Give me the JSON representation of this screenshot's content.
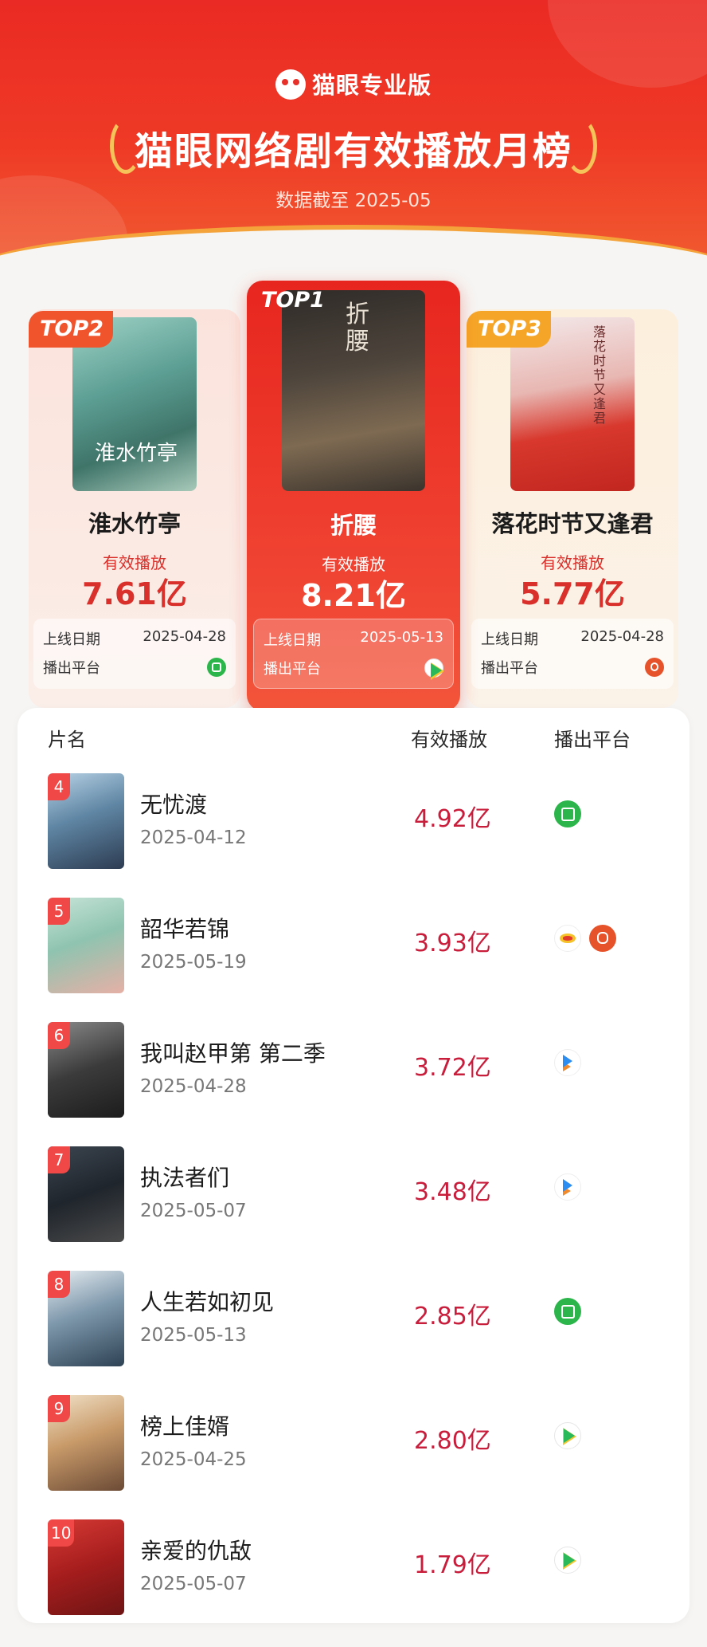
{
  "header": {
    "brand": "猫眼专业版",
    "title": "猫眼网络剧有效播放月榜",
    "subtitle": "数据截至 2025-05"
  },
  "top_cards": [
    {
      "tag": "TOP2",
      "name": "淮水竹亭",
      "label": "有效播放",
      "value": "7.61亿",
      "date_label": "上线日期",
      "date": "2025-04-28",
      "platform_label": "播出平台",
      "platform": "iqiyi-icon",
      "poster_text": "淮水竹亭"
    },
    {
      "tag": "TOP1",
      "name": "折腰",
      "label": "有效播放",
      "value": "8.21亿",
      "date_label": "上线日期",
      "date": "2025-05-13",
      "platform_label": "播出平台",
      "platform": "tencent-video-icon",
      "poster_text": "折腰"
    },
    {
      "tag": "TOP3",
      "name": "落花时节又逢君",
      "label": "有效播放",
      "value": "5.77亿",
      "date_label": "上线日期",
      "date": "2025-04-28",
      "platform_label": "播出平台",
      "platform": "mango-tv-icon",
      "poster_text": "落花时节又逢君"
    }
  ],
  "table": {
    "headers": [
      "片名",
      "有效播放",
      "播出平台"
    ],
    "rows": [
      {
        "rank": "4",
        "name": "无忧渡",
        "date": "2025-04-12",
        "value": "4.92亿",
        "platforms": [
          "iqiyi-icon"
        ]
      },
      {
        "rank": "5",
        "name": "韶华若锦",
        "date": "2025-05-19",
        "value": "3.93亿",
        "platforms": [
          "huashu-icon",
          "mango-tv-icon"
        ]
      },
      {
        "rank": "6",
        "name": "我叫赵甲第 第二季",
        "date": "2025-04-28",
        "value": "3.72亿",
        "platforms": [
          "youku-icon"
        ]
      },
      {
        "rank": "7",
        "name": "执法者们",
        "date": "2025-05-07",
        "value": "3.48亿",
        "platforms": [
          "youku-icon"
        ]
      },
      {
        "rank": "8",
        "name": "人生若如初见",
        "date": "2025-05-13",
        "value": "2.85亿",
        "platforms": [
          "iqiyi-icon"
        ]
      },
      {
        "rank": "9",
        "name": "榜上佳婿",
        "date": "2025-04-25",
        "value": "2.80亿",
        "platforms": [
          "tencent-video-icon"
        ]
      },
      {
        "rank": "10",
        "name": "亲爱的仇敌",
        "date": "2025-05-07",
        "value": "1.79亿",
        "platforms": [
          "tencent-video-icon"
        ]
      }
    ]
  },
  "colors": {
    "accent": "#e8302a",
    "value": "#c91d3c",
    "rank_badge": "#f04747"
  }
}
